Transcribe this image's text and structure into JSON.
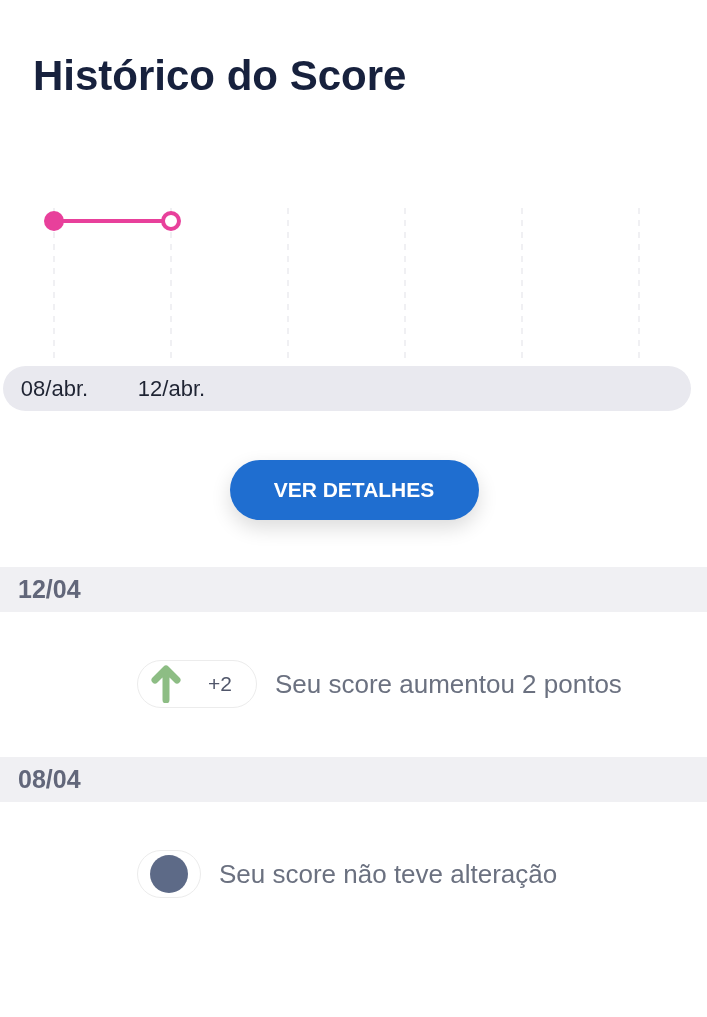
{
  "title": "Histórico do Score",
  "chart": {
    "points": [
      {
        "label": "08/abr.",
        "selected": false
      },
      {
        "label": "12/abr.",
        "selected": true
      }
    ]
  },
  "button": {
    "label": "VER DETALHES"
  },
  "history": [
    {
      "date": "12/04",
      "kind": "increase",
      "change": "+2",
      "message": "Seu score aumentou 2 pontos"
    },
    {
      "date": "08/04",
      "kind": "unchanged",
      "message": "Seu score não teve alteração"
    }
  ]
}
